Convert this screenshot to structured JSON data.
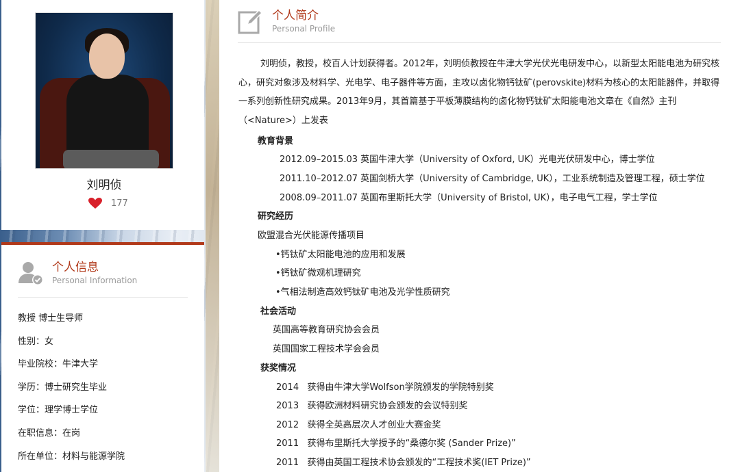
{
  "profile": {
    "name": "刘明侦",
    "likes": "177"
  },
  "info": {
    "title": "个人信息",
    "subtitle": "Personal Information",
    "items": [
      "教授 博士生导师",
      "性别：女",
      "毕业院校：牛津大学",
      "学历：博士研究生毕业",
      "学位：理学博士学位",
      "在职信息：在岗",
      "所在单位：材料与能源学院"
    ]
  },
  "main": {
    "title": "个人简介",
    "subtitle": "Personal Profile",
    "intro": "刘明侦，教授，校百人计划获得者。2012年，刘明侦教授在牛津大学光伏光电研发中心，以新型太阳能电池为研究核心，研究对象涉及材料学、光电学、电子器件等方面，主攻以卤化物钙钛矿(perovskite)材料为核心的太阳能器件，并取得一系列创新性研究成果。2013年9月，其首篇基于平板薄膜结构的卤化物钙钛矿太阳能电池文章在《自然》主刊（<Nature>）上发表",
    "education_heading": "教育背景",
    "education": [
      "2012.09–2015.03 英国牛津大学（University of Oxford, UK）光电光伏研发中心，博士学位",
      "2011.10–2012.07 英国剑桥大学（University of Cambridge, UK），工业系统制造及管理工程，硕士学位",
      "2008.09–2011.07 英国布里斯托大学（University of Bristol, UK），电子电气工程，学士学位"
    ],
    "research_heading": "研究经历",
    "research_project": "欧盟混合光伏能源传播项目",
    "research_items": [
      "•钙钛矿太阳能电池的应用和发展",
      "•钙钛矿微观机理研究",
      "•气相法制造高效钙钛矿电池及光学性质研究"
    ],
    "social_heading": "社会活动",
    "social_items": [
      "英国高等教育研究协会会员",
      "英国国家工程技术学会会员"
    ],
    "awards_heading": "获奖情况",
    "awards": [
      {
        "year": "2014",
        "text": "获得由牛津大学Wolfson学院颁发的学院特别奖"
      },
      {
        "year": "2013",
        "text": "获得欧洲材料研究协会颁发的会议特别奖"
      },
      {
        "year": "2012",
        "text": "获得全英高层次人才创业大赛金奖"
      },
      {
        "year": "2011",
        "text": "获得布里斯托大学授予的“桑德尔奖 (Sander Prize)”"
      },
      {
        "year": "2011",
        "text": "获得由英国工程技术协会颁发的“工程技术奖(IET Prize)”"
      }
    ]
  },
  "colors": {
    "accent": "#b1391a",
    "heart": "#d8202a"
  }
}
